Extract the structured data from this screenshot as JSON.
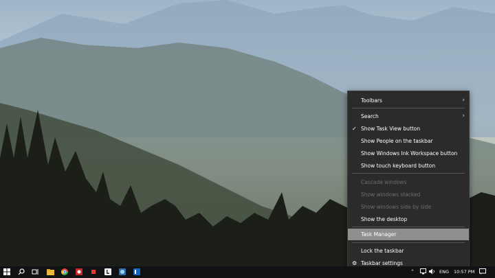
{
  "context_menu": {
    "items": [
      {
        "label": "Toolbars",
        "submenu": true
      },
      {
        "label": "Search",
        "submenu": true
      },
      {
        "label": "Show Task View button",
        "checked": true
      },
      {
        "label": "Show People on the taskbar"
      },
      {
        "label": "Show Windows Ink Workspace button"
      },
      {
        "label": "Show touch keyboard button"
      },
      {
        "label": "Cascade windows",
        "disabled": true
      },
      {
        "label": "Show windows stacked",
        "disabled": true
      },
      {
        "label": "Show windows side by side",
        "disabled": true
      },
      {
        "label": "Show the desktop"
      },
      {
        "label": "Task Manager",
        "highlighted": true
      },
      {
        "label": "Lock the taskbar"
      },
      {
        "label": "Taskbar settings",
        "icon": "gear-icon"
      }
    ]
  },
  "taskbar": {
    "pinned_icons": [
      "windows-start-icon",
      "search-icon",
      "task-view-icon",
      "file-explorer-icon",
      "chrome-icon",
      "app-icon",
      "app-icon",
      "app-icon",
      "app-icon",
      "app-icon"
    ],
    "tray": {
      "language": "ENG",
      "time": "10:57 PM"
    }
  },
  "colors": {
    "menu_bg": "#2b2b2b",
    "menu_highlight": "#8f8f8f",
    "taskbar_bg": "#101214"
  }
}
